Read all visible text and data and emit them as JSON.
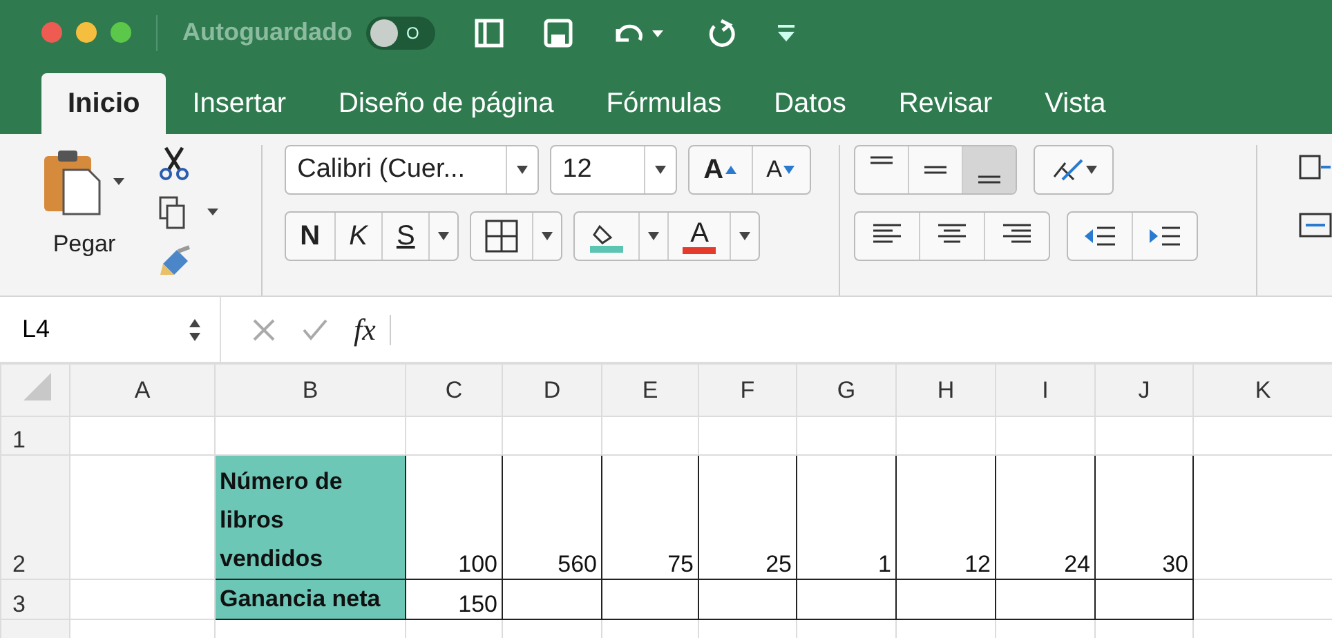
{
  "title_bar": {
    "autosave_label": "Autoguardado",
    "autosave": {
      "on": false,
      "label": "O"
    }
  },
  "tabs": [
    {
      "label": "Inicio",
      "selected": true
    },
    {
      "label": "Insertar",
      "selected": false
    },
    {
      "label": "Diseño de página",
      "selected": false
    },
    {
      "label": "Fórmulas",
      "selected": false
    },
    {
      "label": "Datos",
      "selected": false
    },
    {
      "label": "Revisar",
      "selected": false
    },
    {
      "label": "Vista",
      "selected": false
    }
  ],
  "ribbon": {
    "paste_label": "Pegar",
    "font_name": "Calibri (Cuer...",
    "font_size": "12",
    "grow_label": "A",
    "shrink_label": "A",
    "bold_label": "N",
    "italic_label": "K",
    "underline_label": "S",
    "font_color_label": "A",
    "vertical_align": [
      {
        "kind": "top",
        "selected": false
      },
      {
        "kind": "middle",
        "selected": false
      },
      {
        "kind": "bottom",
        "selected": true
      }
    ],
    "horizontal_align": [
      {
        "kind": "left",
        "selected": false
      },
      {
        "kind": "center",
        "selected": false
      },
      {
        "kind": "right",
        "selected": false
      }
    ]
  },
  "formula_bar": {
    "name_box": "L4",
    "function_label": "fx"
  },
  "sheet": {
    "columns": [
      "A",
      "B",
      "C",
      "D",
      "E",
      "F",
      "G",
      "H",
      "I",
      "J",
      "K"
    ],
    "rows": [
      {
        "number": "1",
        "tall": false,
        "cells": []
      },
      {
        "number": "2",
        "tall": true,
        "cells": [
          {
            "text": "",
            "kind": "empty"
          },
          {
            "text": "Número de libros vendidos",
            "kind": "label"
          },
          {
            "text": "100",
            "kind": "number"
          },
          {
            "text": "560",
            "kind": "number"
          },
          {
            "text": "75",
            "kind": "number"
          },
          {
            "text": "25",
            "kind": "number"
          },
          {
            "text": "1",
            "kind": "number"
          },
          {
            "text": "12",
            "kind": "number"
          },
          {
            "text": "24",
            "kind": "number"
          },
          {
            "text": "30",
            "kind": "number"
          }
        ]
      },
      {
        "number": "3",
        "tall": false,
        "cells": [
          {
            "text": "",
            "kind": "empty"
          },
          {
            "text": "Ganancia neta",
            "kind": "label"
          },
          {
            "text": "150",
            "kind": "number"
          },
          {
            "text": "",
            "kind": "number"
          },
          {
            "text": "",
            "kind": "number"
          },
          {
            "text": "",
            "kind": "number"
          },
          {
            "text": "",
            "kind": "number"
          },
          {
            "text": "",
            "kind": "number"
          },
          {
            "text": "",
            "kind": "number"
          },
          {
            "text": "",
            "kind": "number"
          }
        ]
      },
      {
        "number": "",
        "tall": false,
        "cells": []
      }
    ]
  }
}
